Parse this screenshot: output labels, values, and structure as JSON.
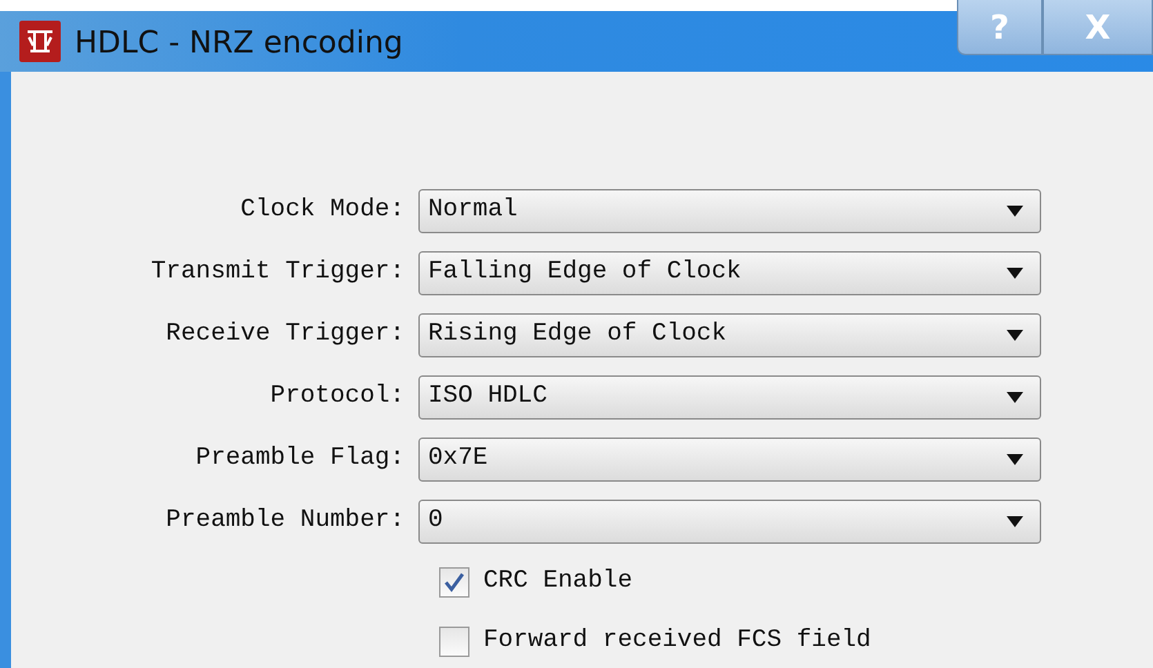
{
  "window": {
    "title": "HDLC - NRZ encoding",
    "buttons": [
      {
        "kind": "help",
        "label": "?"
      },
      {
        "kind": "close",
        "label": "X"
      }
    ]
  },
  "fields": [
    {
      "label": "Clock Mode:",
      "value": "Normal"
    },
    {
      "label": "Transmit Trigger:",
      "value": "Falling Edge of Clock"
    },
    {
      "label": "Receive Trigger:",
      "value": "Rising Edge of Clock"
    },
    {
      "label": "Protocol:",
      "value": "ISO HDLC"
    },
    {
      "label": "Preamble Flag:",
      "value": "0x7E"
    },
    {
      "label": "Preamble Number:",
      "value": "0"
    }
  ],
  "checkboxes": [
    {
      "label": "CRC Enable",
      "checked": true
    },
    {
      "label": "Forward received FCS field",
      "checked": false
    }
  ]
}
